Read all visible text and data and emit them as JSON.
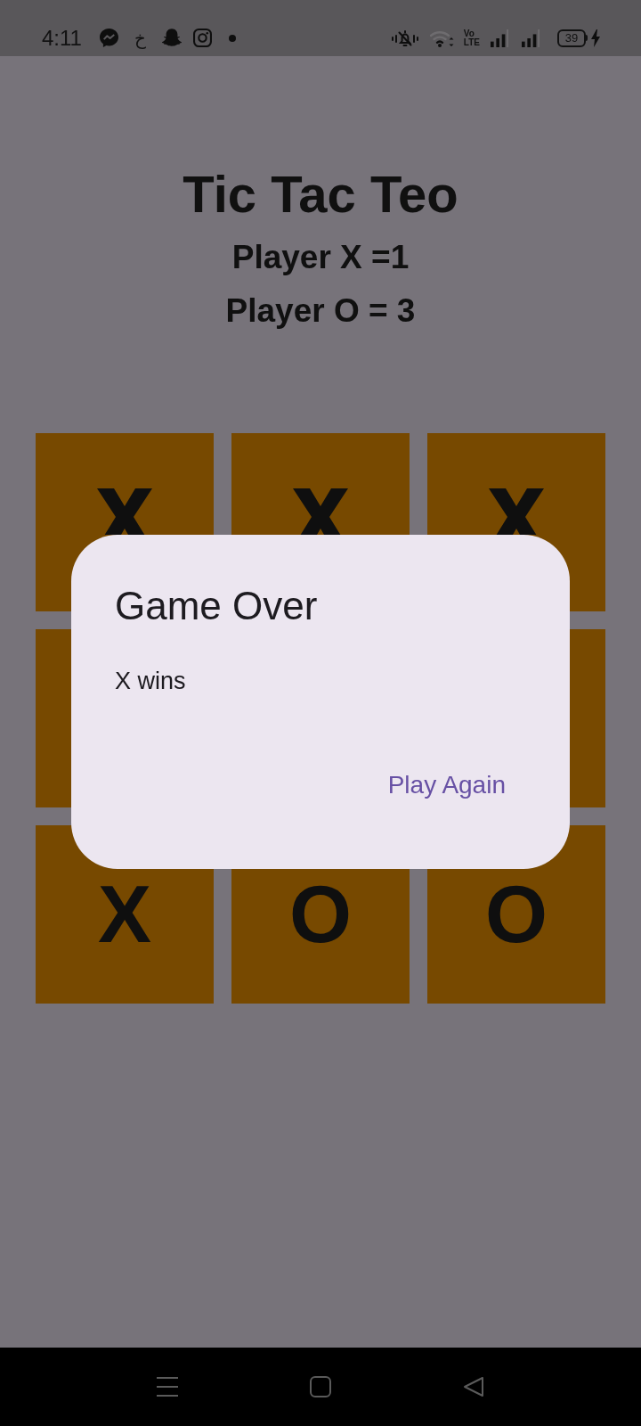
{
  "status_bar": {
    "time": "4:11",
    "notification_glyph": "خ",
    "network_type": [
      "Vo",
      "LTE"
    ],
    "battery": "39"
  },
  "title": "Tic Tac Teo",
  "scores": [
    "Player X =1",
    "Player O = 3"
  ],
  "board": {
    "row_1": [
      {
        "kind": "x"
      },
      {
        "kind": "x"
      },
      {
        "kind": "x"
      }
    ],
    "row_3": [
      {
        "mark": "X"
      },
      {
        "mark": "O"
      },
      {
        "mark": "O"
      }
    ]
  },
  "dialog": {
    "title": "Game Over",
    "message": "X wins",
    "button": "Play Again"
  }
}
